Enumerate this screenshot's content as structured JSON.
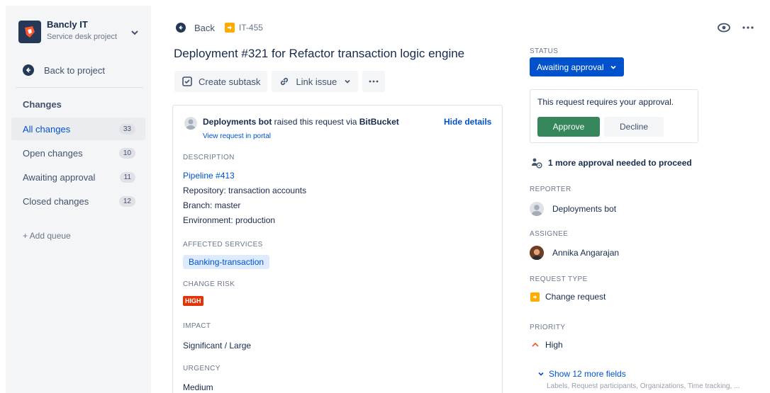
{
  "project": {
    "name": "Bancly IT",
    "subtitle": "Service desk project"
  },
  "sidebar": {
    "back_label": "Back to project",
    "heading": "Changes",
    "queues": [
      {
        "label": "All changes",
        "count": "33",
        "active": true
      },
      {
        "label": "Open changes",
        "count": "10"
      },
      {
        "label": "Awaiting approval",
        "count": "11"
      },
      {
        "label": "Closed changes",
        "count": "12"
      }
    ],
    "add_queue": "+ Add queue"
  },
  "topbar": {
    "back_label": "Back",
    "issue_key": "IT-455"
  },
  "issue": {
    "title": "Deployment #321 for Refactor transaction logic engine",
    "toolbar": {
      "create_subtask": "Create subtask",
      "link_issue": "Link issue"
    },
    "raised_by": "Deployments bot",
    "raised_mid": " raised this request via ",
    "raised_via": "BitBucket",
    "view_portal": "View request in portal",
    "hide_details": "Hide details",
    "description_label": "DESCRIPTION",
    "pipeline_link": "Pipeline #413",
    "repository": "Repository: transaction accounts",
    "branch": "Branch: master",
    "environment": "Environment: production",
    "affected_label": "AFFECTED SERVICES",
    "affected_service": "Banking-transaction",
    "risk_label": "CHANGE RISK",
    "risk_value": "HIGH",
    "impact_label": "IMPACT",
    "impact_value": "Significant / Large",
    "urgency_label": "URGENCY",
    "urgency_value": "Medium"
  },
  "panel": {
    "status_label": "STATUS",
    "status_value": "Awaiting approval",
    "approval_message": "This request requires your approval.",
    "approve": "Approve",
    "decline": "Decline",
    "more_approval": "1 more approval needed to proceed",
    "reporter_label": "REPORTER",
    "reporter": "Deployments bot",
    "assignee_label": "ASSIGNEE",
    "assignee": "Annika Angarajan",
    "request_type_label": "REQUEST TYPE",
    "request_type": "Change request",
    "priority_label": "PRIORITY",
    "priority": "High",
    "show_more": "Show 12 more fields",
    "show_more_sub": "Labels, Request participants, Organizations, Time tracking, ..."
  },
  "colors": {
    "brand_blue": "#0052cc",
    "approve_green": "#36865b",
    "risk_red": "#de350b",
    "change_yellow": "#ffab00"
  },
  "icons": [
    "project-logo-icon",
    "chevron-down-icon",
    "arrow-left-icon",
    "change-type-icon",
    "eye-icon",
    "more-icon",
    "subtask-icon",
    "link-icon",
    "avatar-icon",
    "approvers-icon",
    "priority-high-icon"
  ]
}
